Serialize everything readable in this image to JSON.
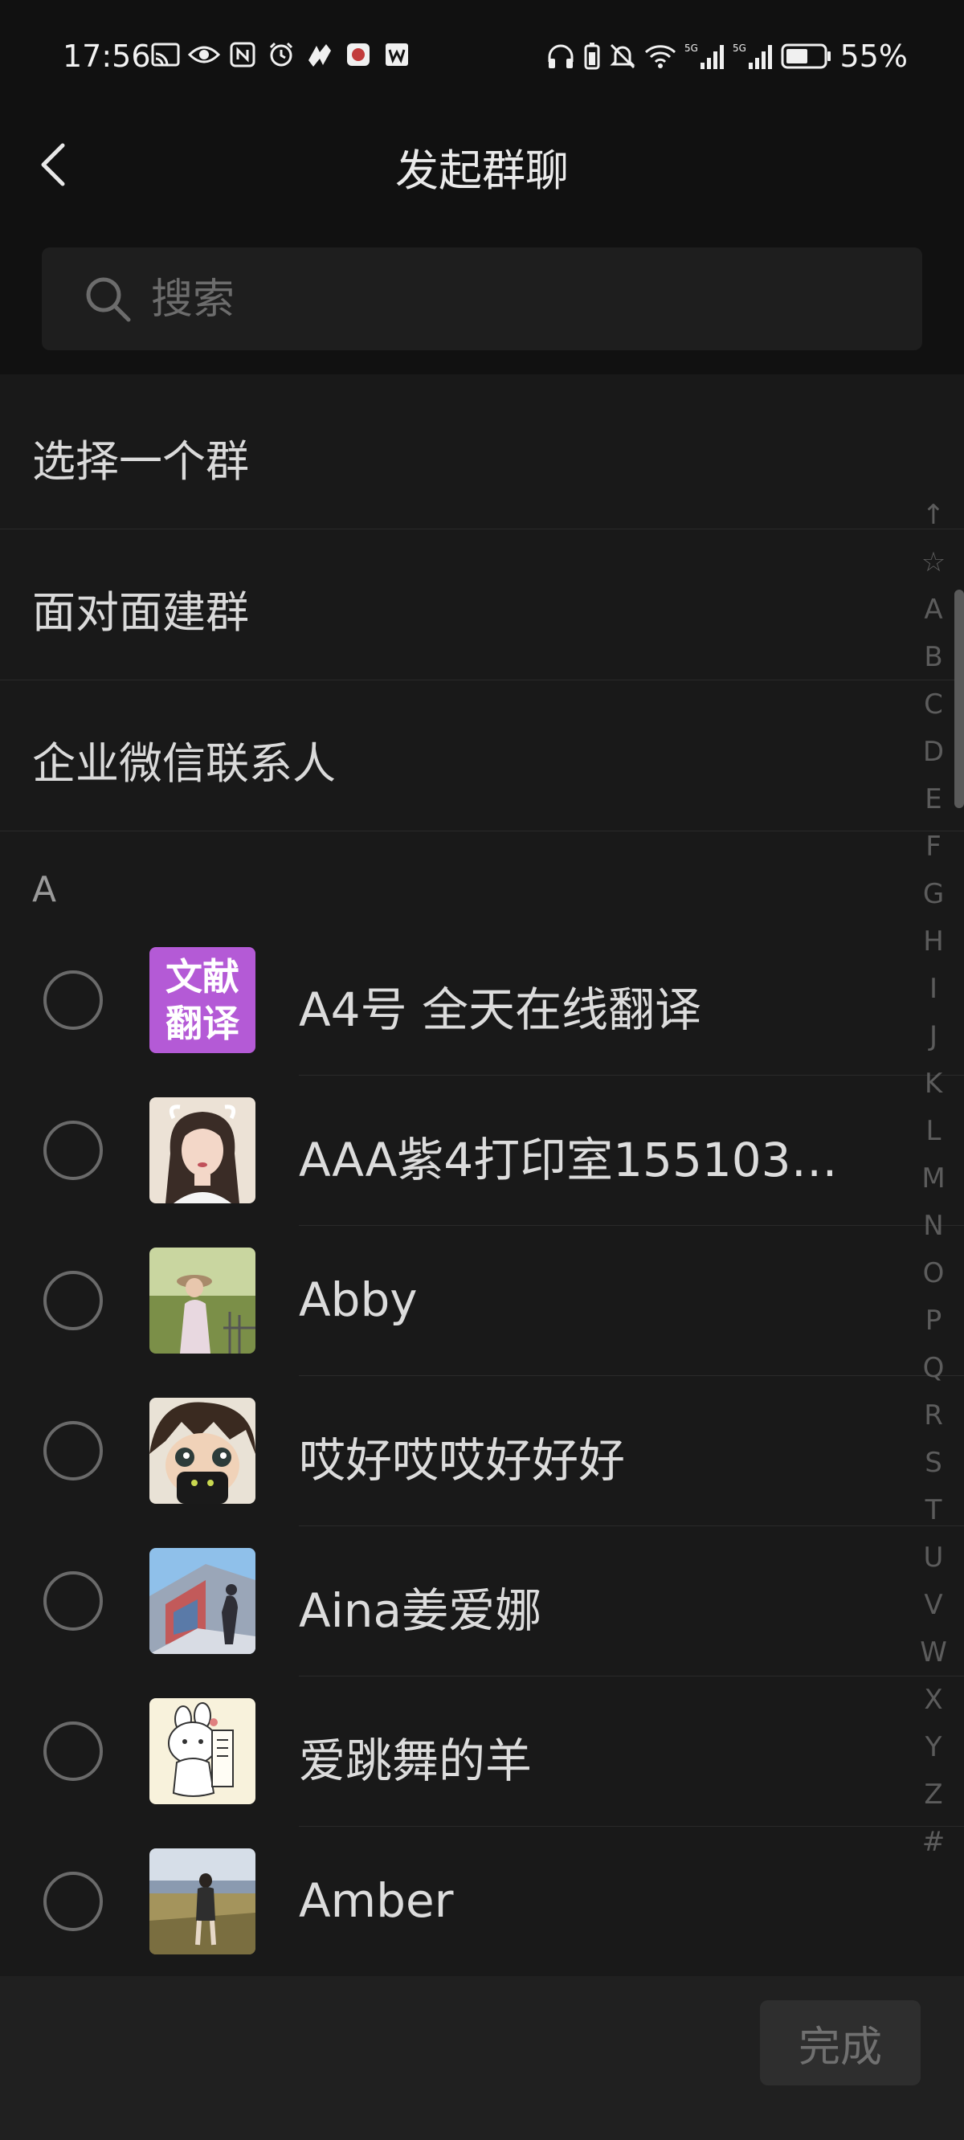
{
  "status_bar": {
    "time": "17:56",
    "battery_percent": "55%",
    "signal_5g": "5G"
  },
  "header": {
    "title": "发起群聊"
  },
  "search": {
    "placeholder": "搜索"
  },
  "menu": [
    {
      "label": "选择一个群"
    },
    {
      "label": "面对面建群"
    },
    {
      "label": "企业微信联系人"
    }
  ],
  "section_header": "A",
  "contacts": [
    {
      "name": "A4号 全天在线翻译",
      "avatar_text_line1": "文献",
      "avatar_text_line2": "翻译",
      "avatar_color": "#b45ad6"
    },
    {
      "name": "AAA紫4打印室1551039...",
      "avatar_color": "#e7dccf"
    },
    {
      "name": "Abby",
      "avatar_color": "#8aa05a"
    },
    {
      "name": "哎好哎哎好好好",
      "avatar_color": "#3c2c24"
    },
    {
      "name": "Aina姜爱娜",
      "avatar_color": "#5a86b8"
    },
    {
      "name": "爱跳舞的羊",
      "avatar_color": "#f6f0d8"
    },
    {
      "name": "Amber",
      "avatar_color": "#8a9470"
    }
  ],
  "index_letters": [
    "↑",
    "☆",
    "A",
    "B",
    "C",
    "D",
    "E",
    "F",
    "G",
    "H",
    "I",
    "J",
    "K",
    "L",
    "M",
    "N",
    "O",
    "P",
    "Q",
    "R",
    "S",
    "T",
    "U",
    "V",
    "W",
    "X",
    "Y",
    "Z",
    "#"
  ],
  "footer": {
    "done_label": "完成"
  }
}
